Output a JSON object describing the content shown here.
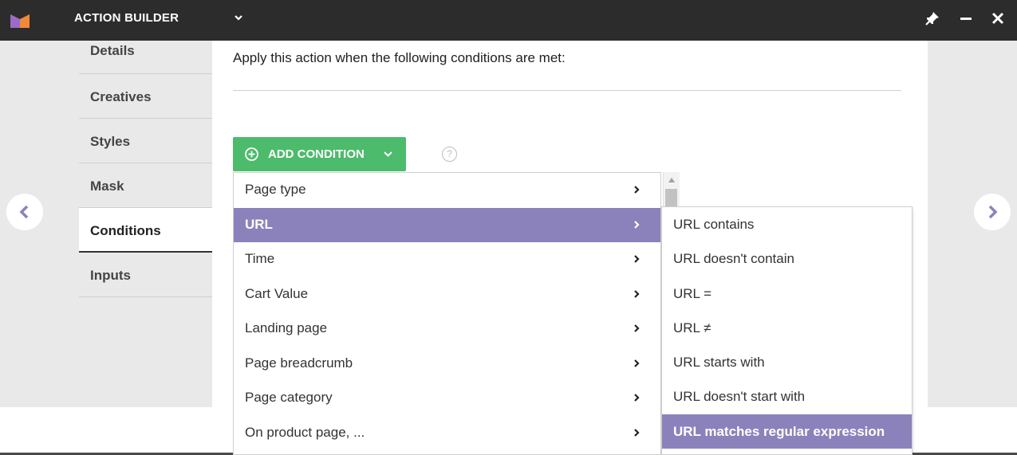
{
  "app": {
    "title": "ACTION BUILDER",
    "brand_color": "#f08a3a",
    "accent_color": "#8b82bc",
    "button_color": "#4cbb6c",
    "window_controls": [
      "pin-icon",
      "minimize-icon",
      "close-icon"
    ]
  },
  "nav": {
    "items": [
      {
        "label": "Details"
      },
      {
        "label": "Creatives"
      },
      {
        "label": "Styles"
      },
      {
        "label": "Mask"
      },
      {
        "label": "Conditions",
        "active": true
      },
      {
        "label": "Inputs"
      }
    ]
  },
  "main": {
    "heading": "Apply this action when the following conditions are met:",
    "add_condition_label": "ADD CONDITION",
    "help_label": "?"
  },
  "dropdown": {
    "items": [
      {
        "label": "Page type"
      },
      {
        "label": "URL",
        "selected": true
      },
      {
        "label": "Time"
      },
      {
        "label": "Cart Value"
      },
      {
        "label": "Landing page"
      },
      {
        "label": "Page breadcrumb"
      },
      {
        "label": "Page category"
      },
      {
        "label": "On product page, ..."
      }
    ]
  },
  "submenu": {
    "items": [
      {
        "label": "URL contains"
      },
      {
        "label": "URL doesn't contain"
      },
      {
        "label": "URL ="
      },
      {
        "label": "URL ≠"
      },
      {
        "label": "URL starts with"
      },
      {
        "label": "URL doesn't start with"
      },
      {
        "label": "URL matches regular expression",
        "selected": true
      }
    ]
  },
  "carousel": {
    "prev_icon": "chevron-left-icon",
    "next_icon": "chevron-right-icon"
  }
}
